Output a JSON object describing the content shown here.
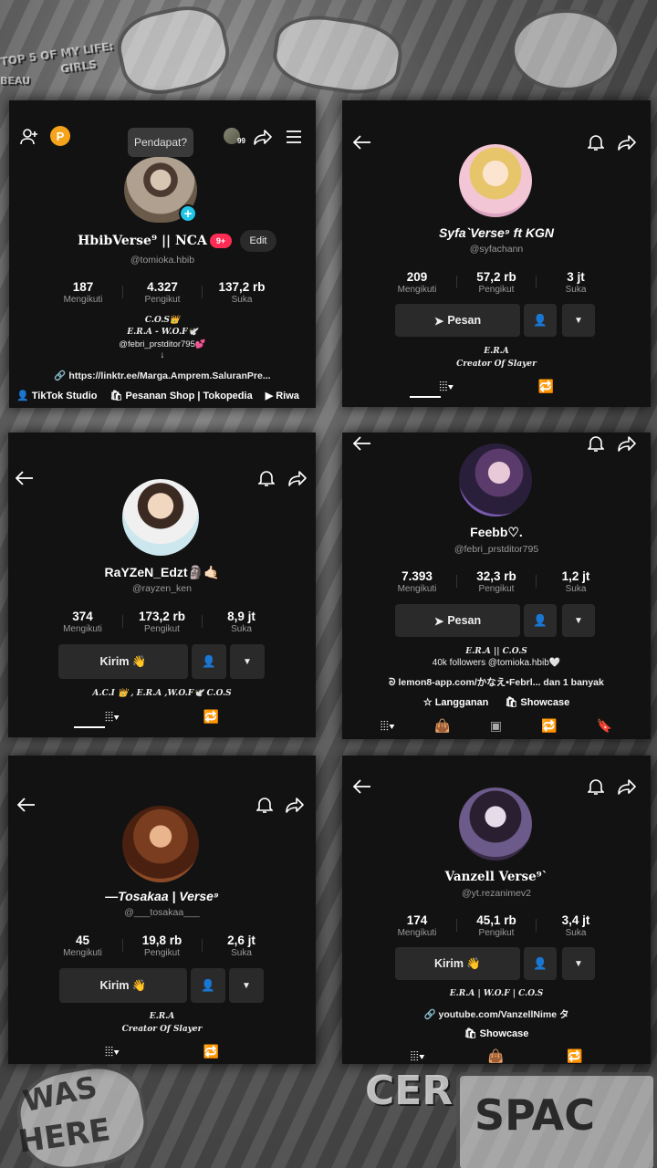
{
  "background": {
    "text1": "TOP 5 OF MY LIFE:",
    "text2": "GIRLS",
    "text3": "BEAU",
    "text4": "WAS",
    "text5": "HERE",
    "text6": "CER",
    "text7": "SPAC"
  },
  "p1": {
    "tooltip": "Pendapat?",
    "share_count": "99",
    "name": "HbibVerse⁹ || NCA",
    "badge": "9+",
    "edit_label": "Edit",
    "handle": "@tomioka.hbib",
    "stats": [
      {
        "value": "187",
        "label": "Mengikuti"
      },
      {
        "value": "4.327",
        "label": "Pengikut"
      },
      {
        "value": "137,2 rb",
        "label": "Suka"
      }
    ],
    "bio1": "C.O.S👑",
    "bio2": "E.R.A - W.O.F🕊️",
    "bio3": "@febri_prstditor795💕",
    "bio4": "↓",
    "link": "https://linktr.ee/Marga.Amprem.SaluranPre...",
    "chips": [
      "TikTok Studio",
      "Pesanan Shop | Tokopedia",
      "Riwa"
    ]
  },
  "p2": {
    "name": "Syfa`Verse⁹ ft KGN",
    "handle": "@syfachann",
    "stats": [
      {
        "value": "209",
        "label": "Mengikuti"
      },
      {
        "value": "57,2 rb",
        "label": "Pengikut"
      },
      {
        "value": "3 jt",
        "label": "Suka"
      }
    ],
    "message_label": "Pesan",
    "bio1": "E.R.A",
    "bio2": "Creator Of Slayer"
  },
  "p3": {
    "name": "RaYZeN_Edzt🗿🤙🏻",
    "handle": "@rayzen_ken",
    "stats": [
      {
        "value": "374",
        "label": "Mengikuti"
      },
      {
        "value": "173,2 rb",
        "label": "Pengikut"
      },
      {
        "value": "8,9 jt",
        "label": "Suka"
      }
    ],
    "send_label": "Kirim 👋",
    "bio1": "A.C.I 👑 , E.R.A ,W.O.F🕊️ C.O.S"
  },
  "p4": {
    "name": "Feebb♡.",
    "handle": "@febri_prstditor795",
    "stats": [
      {
        "value": "7.393",
        "label": "Mengikuti"
      },
      {
        "value": "32,3 rb",
        "label": "Pengikut"
      },
      {
        "value": "1,2 jt",
        "label": "Suka"
      }
    ],
    "message_label": "Pesan",
    "bio1": "E.R.A || C.O.S",
    "bio2": "40k followers @tomioka.hbib🤍",
    "link": "lemon8-app.com/かなえ•Febrl... dan 1 banyak",
    "chip1": "Langganan",
    "chip2": "Showcase"
  },
  "p5": {
    "name": "—Tosakaa | Verse⁹",
    "handle": "@___tosakaa___",
    "stats": [
      {
        "value": "45",
        "label": "Mengikuti"
      },
      {
        "value": "19,8 rb",
        "label": "Pengikut"
      },
      {
        "value": "2,6 jt",
        "label": "Suka"
      }
    ],
    "send_label": "Kirim 👋",
    "bio1": "E.R.A",
    "bio2": "Creator Of Slayer"
  },
  "p6": {
    "name": "Vanzell Verse⁹`",
    "handle": "@yt.rezanimev2",
    "stats": [
      {
        "value": "174",
        "label": "Mengikuti"
      },
      {
        "value": "45,1 rb",
        "label": "Pengikut"
      },
      {
        "value": "3,4 jt",
        "label": "Suka"
      }
    ],
    "send_label": "Kirim 👋",
    "bio1": "E.R.A | W.O.F | C.O.S",
    "link": "youtube.com/VanzellNime タ",
    "chip1": "Showcase"
  }
}
